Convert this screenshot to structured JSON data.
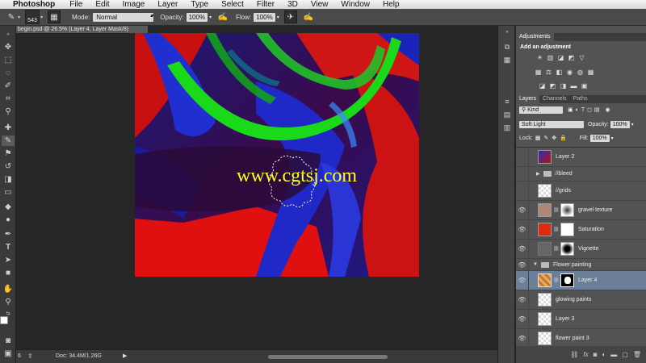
{
  "menubar": {
    "app_name": "Photoshop",
    "items": [
      "File",
      "Edit",
      "Image",
      "Layer",
      "Type",
      "Select",
      "Filter",
      "3D",
      "View",
      "Window",
      "Help"
    ]
  },
  "options_bar": {
    "brush_size": "543",
    "mode_label": "Mode:",
    "mode_value": "Normal",
    "opacity_label": "Opacity:",
    "opacity_value": "100%",
    "flow_label": "Flow:",
    "flow_value": "100%"
  },
  "document": {
    "tab_title": "begin.psd @ 26.5% (Layer 4, Layer Mask/8)",
    "status_zoom": "6",
    "status_doc": "Doc: 34.4M/1.26G",
    "watermark": "www.cgtsj.com"
  },
  "adjustments": {
    "tab_label": "Adjustments",
    "heading": "Add an adjustment"
  },
  "layers_panel": {
    "tabs": [
      "Layers",
      "Channels",
      "Paths"
    ],
    "filter_kind": "Kind",
    "blend_mode": "Soft Light",
    "opacity_label": "Opacity:",
    "opacity_value": "100%",
    "lock_label": "Lock:",
    "fill_label": "Fill:",
    "fill_value": "100%",
    "layers": [
      {
        "name": "Layer 2",
        "visible": false,
        "kind": "pixel"
      },
      {
        "name": "//bleed",
        "visible": false,
        "kind": "group"
      },
      {
        "name": "//grids",
        "visible": false,
        "kind": "pixel"
      },
      {
        "name": "gravel texture",
        "visible": true,
        "kind": "masked"
      },
      {
        "name": "Saturation",
        "visible": true,
        "kind": "adjustment"
      },
      {
        "name": "Vignette",
        "visible": true,
        "kind": "adjustment"
      },
      {
        "name": "Flower painting",
        "visible": true,
        "kind": "group-open"
      },
      {
        "name": "Layer 4",
        "visible": true,
        "kind": "masked",
        "selected": true
      },
      {
        "name": "glowing paints",
        "visible": true,
        "kind": "pixel"
      },
      {
        "name": "Layer 3",
        "visible": true,
        "kind": "pixel"
      },
      {
        "name": "flower paint 3",
        "visible": true,
        "kind": "pixel"
      }
    ]
  },
  "colors": {
    "ui_dark": "#262626",
    "panel": "#535353",
    "selected_layer": "#6b7f99",
    "watermark": "#ffff22"
  }
}
